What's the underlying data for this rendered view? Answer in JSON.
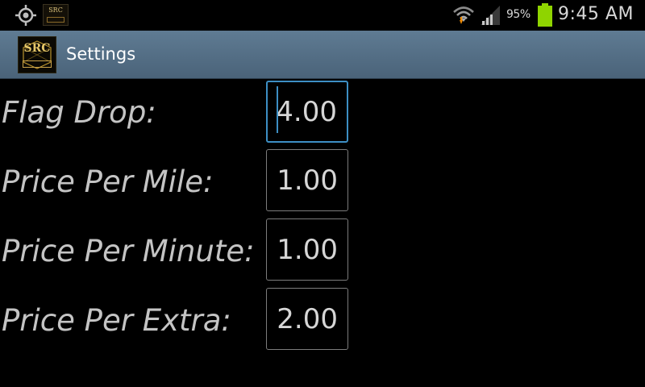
{
  "status_bar": {
    "battery_percent": "95%",
    "time": "9:45 AM",
    "icons": [
      "gps-icon",
      "app-notification-icon",
      "wifi-icon",
      "signal-icon",
      "battery-icon"
    ]
  },
  "action_bar": {
    "title": "Settings",
    "logo_text": "SRC"
  },
  "form": {
    "fields": [
      {
        "label": "Flag Drop:",
        "value": "4.00",
        "focused": true
      },
      {
        "label": "Price Per Mile:",
        "value": "1.00",
        "focused": false
      },
      {
        "label": "Price Per Minute:",
        "value": "1.00",
        "focused": false
      },
      {
        "label": "Price Per Extra:",
        "value": "2.00",
        "focused": false
      }
    ]
  },
  "colors": {
    "background": "#000000",
    "action_bar": "#56708a",
    "focus_accent": "#3d8fc4",
    "battery_fill": "#8fd400",
    "text": "#c4c4c4"
  }
}
